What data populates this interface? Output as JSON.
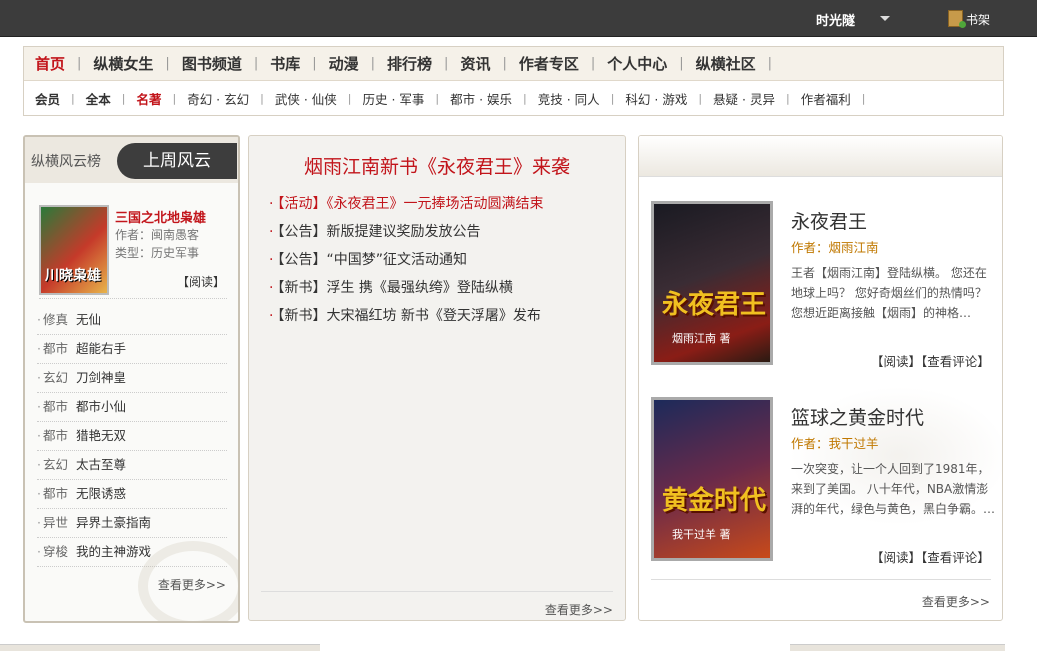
{
  "topbar": {
    "username": "时光隧",
    "shelf": "书架"
  },
  "nav": {
    "primary": [
      "首页",
      "纵横女生",
      "图书频道",
      "书库",
      "动漫",
      "排行榜",
      "资讯",
      "作者专区",
      "个人中心",
      "纵横社区"
    ],
    "secondary": [
      "会员",
      "全本",
      "名著",
      "奇幻 · 玄幻",
      "武侠 · 仙侠",
      "历史 · 军事",
      "都市 · 娱乐",
      "竞技 · 同人",
      "科幻 · 游戏",
      "悬疑 · 灵异",
      "作者福利"
    ]
  },
  "left": {
    "head_title1": "纵横风云榜",
    "head_title2": "上周风云",
    "feature": {
      "cover_text": "川晓枭雄",
      "name": "三国之北地枭雄",
      "author": "作者：闽南愚客",
      "type": "类型：历史军事",
      "read": "【阅读】"
    },
    "list": [
      {
        "cat": "修真",
        "title": "无仙"
      },
      {
        "cat": "都市",
        "title": "超能右手"
      },
      {
        "cat": "玄幻",
        "title": "刀剑神皇"
      },
      {
        "cat": "都市",
        "title": "都市小仙"
      },
      {
        "cat": "都市",
        "title": "猎艳无双"
      },
      {
        "cat": "玄幻",
        "title": "太古至尊"
      },
      {
        "cat": "都市",
        "title": "无限诱惑"
      },
      {
        "cat": "异世",
        "title": "异界土豪指南"
      },
      {
        "cat": "穿梭",
        "title": "我的主神游戏"
      }
    ],
    "more": "查看更多>>"
  },
  "middle": {
    "title": "烟雨江南新书《永夜君王》来袭",
    "news": [
      "【活动】《永夜君王》一元捧场活动圆满结束",
      "【公告】新版提建议奖励发放公告",
      "【公告】“中国梦”征文活动通知",
      "【新书】浮生 携《最强纨绔》登陆纵横",
      "【新书】大宋福红坊 新书《登天浮屠》发布"
    ],
    "more": "查看更多>>"
  },
  "right": {
    "books": [
      {
        "cover_text": "永夜君王",
        "cover_author": "烟雨江南 著",
        "title": "永夜君王",
        "author_label": "作者：",
        "author": "烟雨江南",
        "desc": "王者【烟雨江南】登陆纵横。 您还在地球上吗？ 您好奇烟丝们的热情吗？ 您想近距离接触【烟雨】的神格…",
        "links": "【阅读】【查看评论】"
      },
      {
        "cover_text": "黄金时代",
        "cover_author": "我干过羊 著",
        "title": "篮球之黄金时代",
        "author_label": "作者：",
        "author": "我干过羊",
        "desc": "一次突变，让一个人回到了1981年，来到了美国。 八十年代，NBA激情澎湃的年代，绿色与黄色，黑白争霸。…",
        "links": "【阅读】【查看评论】"
      }
    ],
    "more": "查看更多>>"
  },
  "colors": {
    "accent": "#c2151b",
    "topbar": "#3c3c3c",
    "author": "#c07800"
  }
}
